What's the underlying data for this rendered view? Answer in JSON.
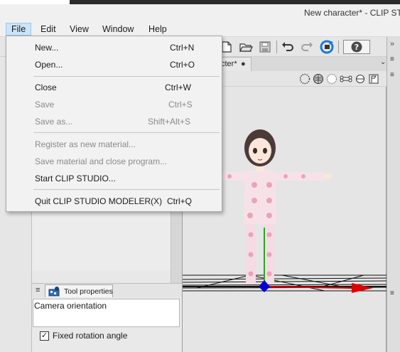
{
  "window": {
    "title": "New character* - CLIP STU"
  },
  "menubar": {
    "items": [
      {
        "label": "File",
        "active": true
      },
      {
        "label": "Edit"
      },
      {
        "label": "View"
      },
      {
        "label": "Window"
      },
      {
        "label": "Help"
      }
    ]
  },
  "toolbar": {
    "icons": [
      "new-file-icon",
      "open-folder-icon",
      "save-icon",
      "undo-icon",
      "redo-icon",
      "refresh-icon",
      "help-icon"
    ]
  },
  "document_tab": {
    "label": "cter*",
    "modified_marker": "●"
  },
  "file_menu": {
    "items": [
      {
        "label": "New...",
        "shortcut": "Ctrl+N",
        "enabled": true
      },
      {
        "label": "Open...",
        "shortcut": "Ctrl+O",
        "enabled": true
      },
      {
        "label": "Close",
        "shortcut": "Ctrl+W",
        "enabled": true
      },
      {
        "label": "Save",
        "shortcut": "Ctrl+S",
        "enabled": false
      },
      {
        "label": "Save as...",
        "shortcut": "Shift+Alt+S",
        "enabled": false
      },
      {
        "label": "Register as new material...",
        "shortcut": "",
        "enabled": false
      },
      {
        "label": "Save material and close program...",
        "shortcut": "",
        "enabled": false
      },
      {
        "label": "Start CLIP STUDIO...",
        "shortcut": "",
        "enabled": true
      },
      {
        "label": "Quit CLIP STUDIO MODELER(X)",
        "shortcut": "Ctrl+Q",
        "enabled": true
      }
    ]
  },
  "tool_properties": {
    "tab_label": "Tool properties",
    "camera_label": "Camera orientation",
    "fixed_rotation_label": "Fixed rotation angle",
    "fixed_rotation_checked": true
  },
  "colors": {
    "menu_active_bg": "#cce4f7",
    "axis_x": "#e00000",
    "axis_y": "#00c000",
    "axis_z": "#0000d0"
  }
}
